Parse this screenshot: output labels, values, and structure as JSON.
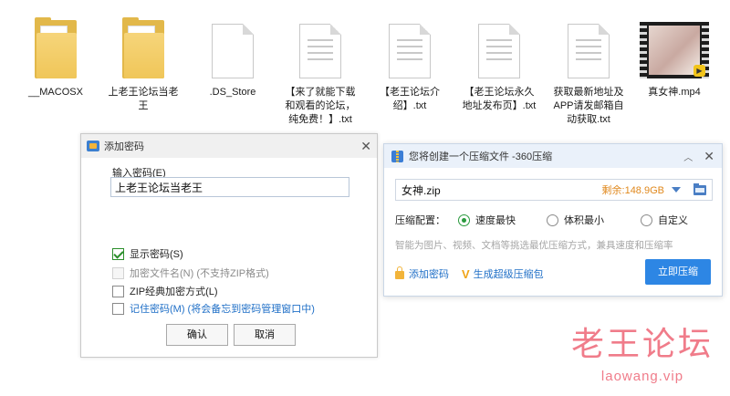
{
  "files": [
    {
      "name": "__MACOSX",
      "type": "folder",
      "icon": "folder-icon"
    },
    {
      "name": "上老王论坛当老\n王",
      "type": "folder",
      "icon": "folder-icon"
    },
    {
      "name": ".DS_Store",
      "type": "file",
      "icon": "file-icon"
    },
    {
      "name": "【来了就能下载\n和观看的论坛，\n纯免费！】.txt",
      "type": "txt",
      "icon": "text-file-icon"
    },
    {
      "name": "【老王论坛介\n绍】.txt",
      "type": "txt",
      "icon": "text-file-icon"
    },
    {
      "name": "【老王论坛永久\n地址发布页】.txt",
      "type": "txt",
      "icon": "text-file-icon"
    },
    {
      "name": "获取最新地址及\nAPP请发邮箱自\n动获取.txt",
      "type": "txt",
      "icon": "text-file-icon"
    },
    {
      "name": "真女神.mp4",
      "type": "video",
      "icon": "video-file-icon"
    }
  ],
  "password_dialog": {
    "title": "添加密码",
    "close": "✕",
    "input_label": "输入密码(E)",
    "password_value": "上老王论坛当老王",
    "options": [
      {
        "label": "显示密码(S)",
        "checked": true,
        "disabled": false
      },
      {
        "label": "加密文件名(N) (不支持ZIP格式)",
        "checked": false,
        "disabled": true
      },
      {
        "label": "ZIP经典加密方式(L)",
        "checked": false,
        "disabled": false
      },
      {
        "label": "记住密码(M) (将会备忘到密码管理窗口中)",
        "checked": false,
        "disabled": false
      }
    ],
    "ok": "确认",
    "cancel": "取消"
  },
  "compress_dialog": {
    "title": "您将创建一个压缩文件 -360压缩",
    "close": "✕",
    "chevron": "︿",
    "filename": "女神.zip",
    "remaining": "剩余:148.9GB",
    "config_label": "压缩配置：",
    "modes": [
      "速度最快",
      "体积最小",
      "自定义"
    ],
    "selected_mode": 0,
    "hint": "智能为图片、视频、文档等挑选最优压缩方式，兼具速度和压缩率",
    "add_password": "添加密码",
    "super_pkg": "生成超级压缩包",
    "compress_now": "立即压缩",
    "accent": "#2d86e4"
  },
  "watermark": {
    "title": "老王论坛",
    "url": "laowang.vip"
  }
}
